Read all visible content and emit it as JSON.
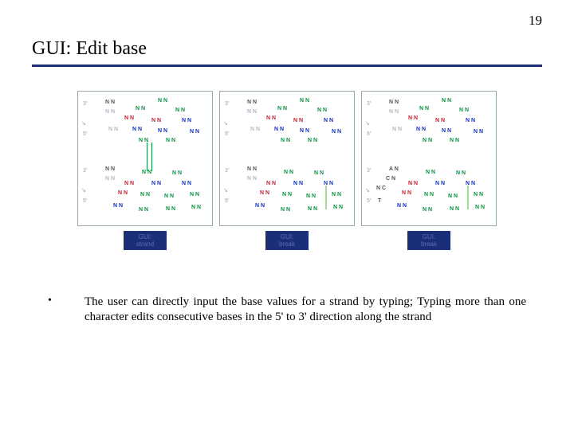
{
  "page_number": "19",
  "title": "GUI: Edit base",
  "panels": [
    {
      "button": {
        "line1": "GUI:",
        "line2": "strand"
      }
    },
    {
      "button": {
        "line1": "GUI:",
        "line2": "break"
      }
    },
    {
      "button": {
        "line1": "GUI:",
        "line2": "break"
      }
    }
  ],
  "labels": {
    "three_prime": "3'",
    "five_prime": "5'",
    "NN": "N N",
    "AN": "A N",
    "CN": "C N",
    "T": "T",
    "NC": "N C"
  },
  "bullet": "•",
  "paragraph": "The user can directly input the base values for a strand by typing; Typing more than one character edits consecutive bases in the 5' to 3' direction along the strand"
}
